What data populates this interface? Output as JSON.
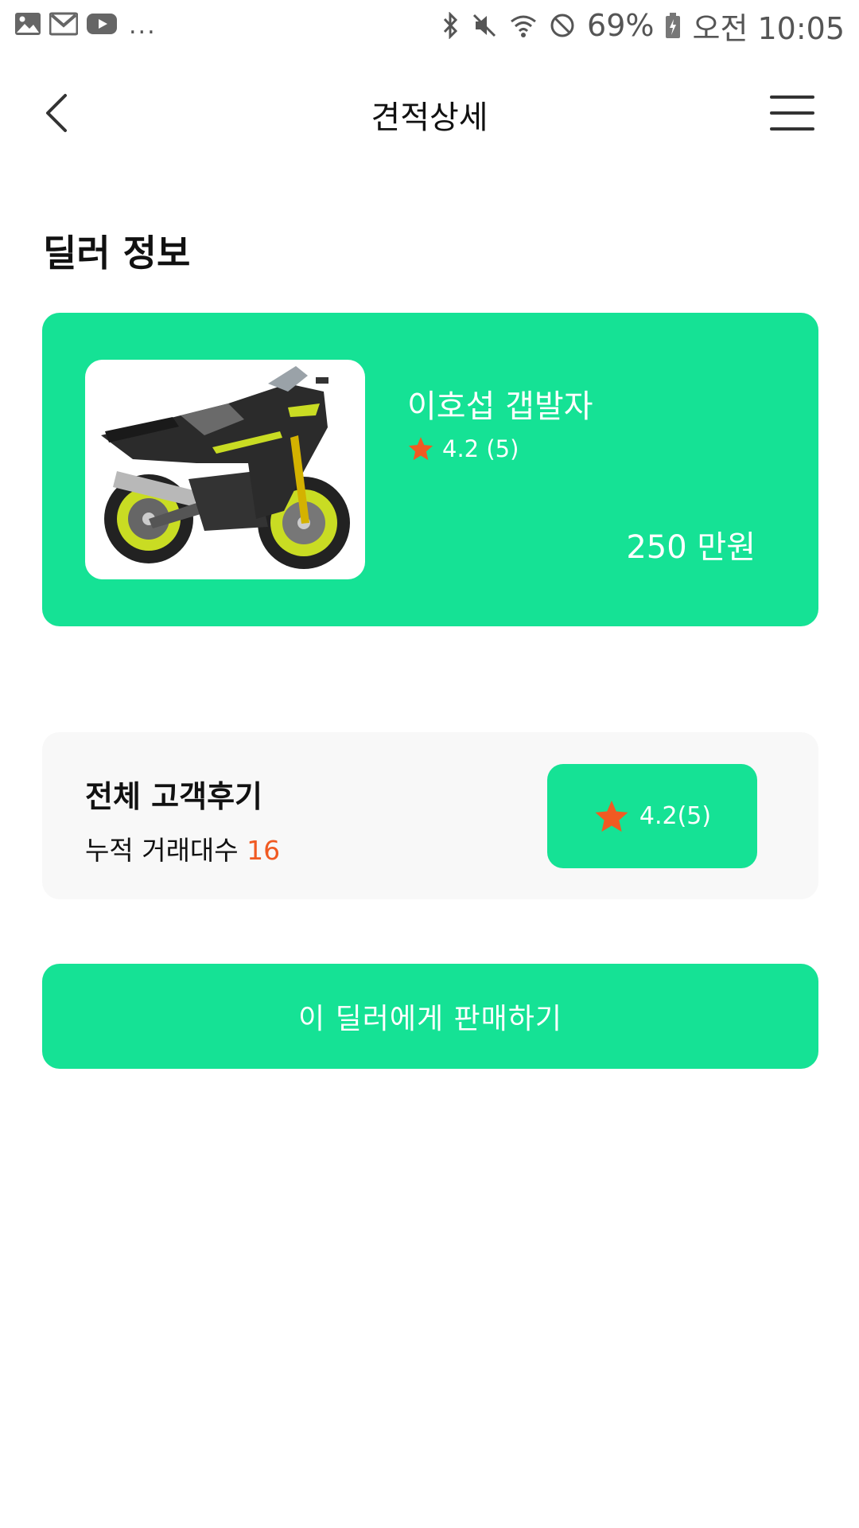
{
  "status_bar": {
    "notification_icons": [
      "gallery-icon",
      "gmail-icon",
      "youtube-icon"
    ],
    "more": "...",
    "system_icons": [
      "bluetooth-icon",
      "mute-icon",
      "wifi-icon",
      "do-not-disturb-icon"
    ],
    "battery": "69%",
    "time": "오전 10:05"
  },
  "header": {
    "title": "견적상세"
  },
  "section": {
    "title": "딜러 정보"
  },
  "dealer": {
    "name": "이호섭 갭발자",
    "rating": "4.2 (5)",
    "price": "250 만원",
    "image_desc": "motorcycle"
  },
  "reviews": {
    "title": "전체 고객후기",
    "trades_label": "누적 거래대수",
    "trades_count": "16",
    "rating": "4.2(5)"
  },
  "cta": {
    "label": "이 딜러에게 판매하기"
  },
  "colors": {
    "accent": "#15e295",
    "star": "#f05a22",
    "highlight": "#f05a22",
    "card_bg": "#f8f8f8"
  }
}
